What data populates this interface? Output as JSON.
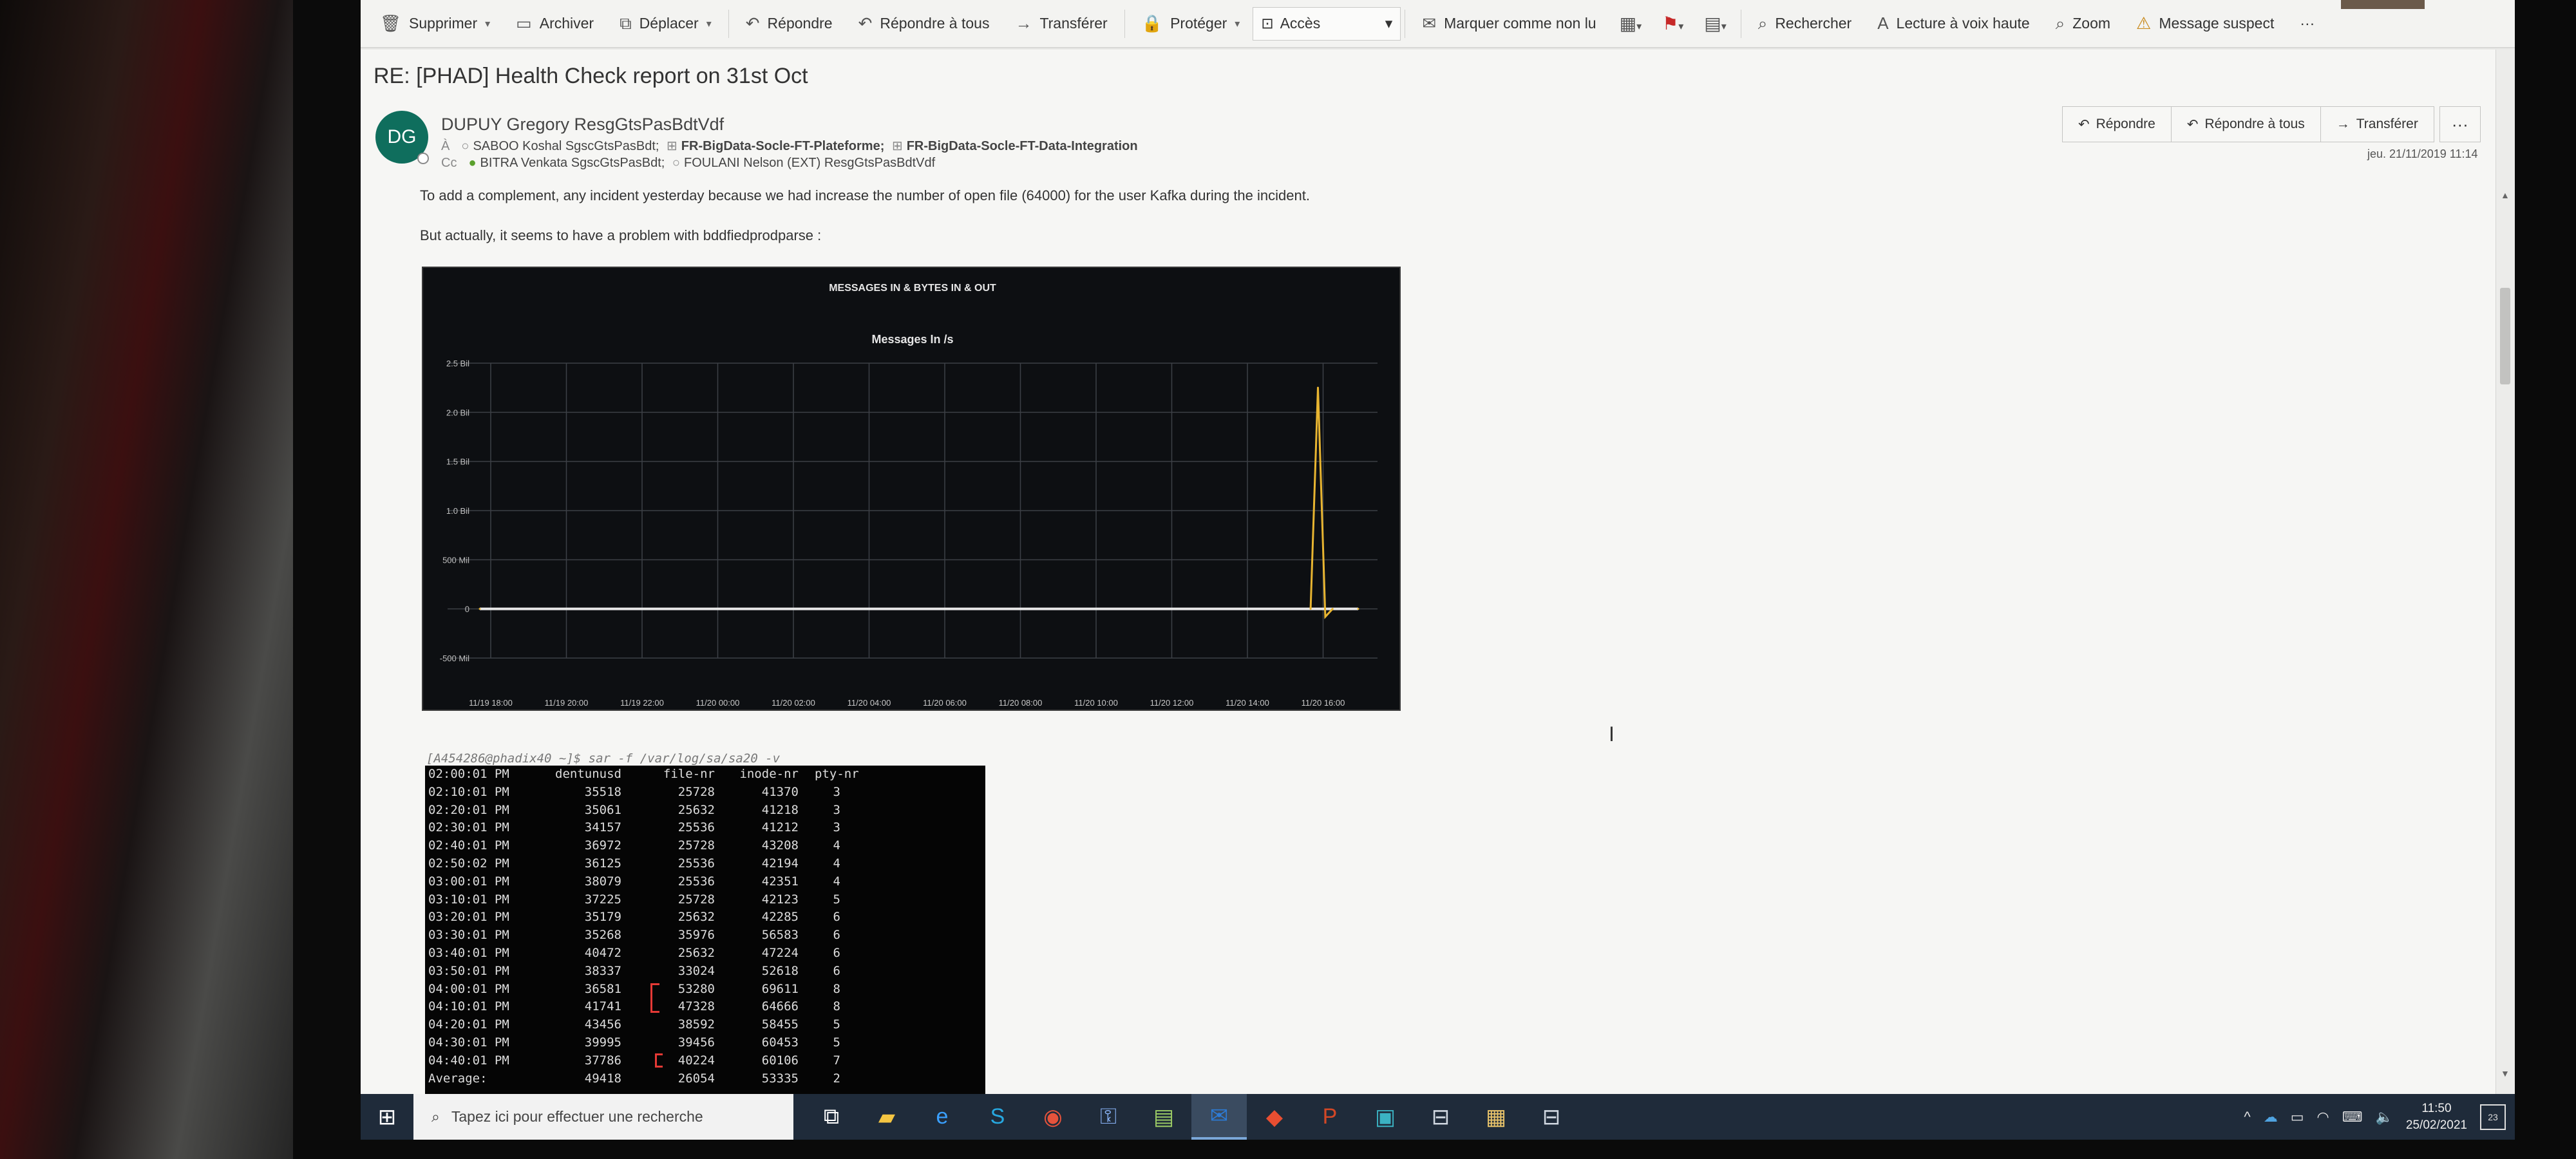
{
  "ribbon": {
    "items": [
      {
        "label": "Supprimer",
        "icon": "trash-icon",
        "caret": true
      },
      {
        "label": "Archiver",
        "icon": "archive-icon",
        "caret": false
      },
      {
        "label": "Déplacer",
        "icon": "move-icon",
        "caret": true
      },
      {
        "label": "Répondre",
        "icon": "reply-icon",
        "caret": false
      },
      {
        "label": "Répondre à tous",
        "icon": "reply-all-icon",
        "caret": false
      },
      {
        "label": "Transférer",
        "icon": "forward-icon",
        "caret": false
      },
      {
        "label": "Protéger",
        "icon": "protect-lock-icon",
        "caret": true
      }
    ],
    "access_combo": "Accès",
    "items2": [
      {
        "label": "Marquer comme non lu",
        "icon": "mark-unread-icon"
      },
      {
        "label": "Rechercher",
        "icon": "search-icon"
      },
      {
        "label": "Lecture à voix haute",
        "icon": "read-aloud-icon"
      },
      {
        "label": "Zoom",
        "icon": "zoom-icon"
      },
      {
        "label": "Message suspect",
        "icon": "report-message-icon"
      }
    ],
    "more": "···"
  },
  "message": {
    "subject": "RE: [PHAD] Health Check report on 31st Oct",
    "avatar_initials": "DG",
    "sender": "DUPUY Gregory ResgGtsPasBdtVdf",
    "to_label": "À",
    "to": [
      "SABOO Koshal SgscGtsPasBdt;",
      "FR-BigData-Socle-FT-Plateforme;",
      "FR-BigData-Socle-FT-Data-Integration"
    ],
    "cc_label": "Cc",
    "cc": [
      "BITRA Venkata SgscGtsPasBdt;",
      "FOULANI Nelson (EXT) ResgGtsPasBdtVdf"
    ],
    "actions": {
      "reply": "Répondre",
      "reply_all": "Répondre à tous",
      "forward": "Transférer",
      "more": "···"
    },
    "date": "jeu. 21/11/2019 11:14",
    "paragraph1": "To add a complement, any incident yesterday because we had increase the number of open file (64000) for the user Kafka during the incident.",
    "paragraph2": "But actually, it seems to have a problem with bddfiedprodparse :"
  },
  "chart_data": {
    "type": "line",
    "title": "MESSAGES IN & BYTES IN & OUT",
    "subtitle": "Messages In /s",
    "x_ticks": [
      "11/19 18:00",
      "11/19 20:00",
      "11/19 22:00",
      "11/20 00:00",
      "11/20 02:00",
      "11/20 04:00",
      "11/20 06:00",
      "11/20 08:00",
      "11/20 10:00",
      "11/20 12:00",
      "11/20 14:00",
      "11/20 16:00"
    ],
    "y_ticks": [
      "2.5 Bil",
      "2.0 Bil",
      "1.5 Bil",
      "1.0 Bil",
      "500 Mil",
      "0",
      "-500 Mil"
    ],
    "ylim": [
      -500,
      2500
    ],
    "y_unit": "Mil",
    "grid": true,
    "series": [
      {
        "color": "#e7e7e7",
        "spike_color": "#e8b531",
        "x": [
          0,
          11.35,
          11.45,
          11.55,
          11.65,
          12
        ],
        "y": [
          0,
          0,
          2250,
          -80,
          0,
          0
        ]
      }
    ]
  },
  "terminal": {
    "command": "[A454286@phadix40 ~]$ sar -f /var/log/sa/sa20 -v",
    "header": [
      "02:00:01 PM",
      "dentunusd",
      "file-nr",
      "inode-nr",
      "pty-nr"
    ],
    "rows": [
      [
        "02:10:01 PM",
        "35518",
        "25728",
        "41370",
        "3"
      ],
      [
        "02:20:01 PM",
        "35061",
        "25632",
        "41218",
        "3"
      ],
      [
        "02:30:01 PM",
        "34157",
        "25536",
        "41212",
        "3"
      ],
      [
        "02:40:01 PM",
        "36972",
        "25728",
        "43208",
        "4"
      ],
      [
        "02:50:02 PM",
        "36125",
        "25536",
        "42194",
        "4"
      ],
      [
        "03:00:01 PM",
        "38079",
        "25536",
        "42351",
        "4"
      ],
      [
        "03:10:01 PM",
        "37225",
        "25728",
        "42123",
        "5"
      ],
      [
        "03:20:01 PM",
        "35179",
        "25632",
        "42285",
        "6"
      ],
      [
        "03:30:01 PM",
        "35268",
        "35976",
        "56583",
        "6"
      ],
      [
        "03:40:01 PM",
        "40472",
        "25632",
        "47224",
        "6"
      ],
      [
        "03:50:01 PM",
        "38337",
        "33024",
        "52618",
        "6"
      ],
      [
        "04:00:01 PM",
        "36581",
        "53280",
        "69611",
        "8"
      ],
      [
        "04:10:01 PM",
        "41741",
        "47328",
        "64666",
        "8"
      ],
      [
        "04:20:01 PM",
        "43456",
        "38592",
        "58455",
        "5"
      ],
      [
        "04:30:01 PM",
        "39995",
        "39456",
        "60453",
        "5"
      ],
      [
        "04:40:01 PM",
        "37786",
        "40224",
        "60106",
        "7"
      ],
      [
        "Average:",
        "49418",
        "26054",
        "53335",
        "2"
      ]
    ]
  },
  "taskbar": {
    "search_placeholder": "Tapez ici pour effectuer une recherche",
    "apps": [
      "task-view-icon",
      "file-explorer-icon",
      "edge-icon",
      "skype-icon",
      "chrome-icon",
      "keepass-icon",
      "notepad-icon",
      "outlook-icon",
      "git-icon",
      "powerpoint-icon",
      "app-icon",
      "remote-desktop-icon",
      "folder-app-icon",
      "remote-desktop-icon-2"
    ],
    "time": "11:50",
    "date": "25/02/2021",
    "notifications": "23"
  },
  "colors": {
    "avatar": "#0f6e5d",
    "taskbar": "#1f2b3a",
    "chart_bg": "#0d0f12",
    "spike": "#e8b531",
    "highlight": "#e53935"
  }
}
